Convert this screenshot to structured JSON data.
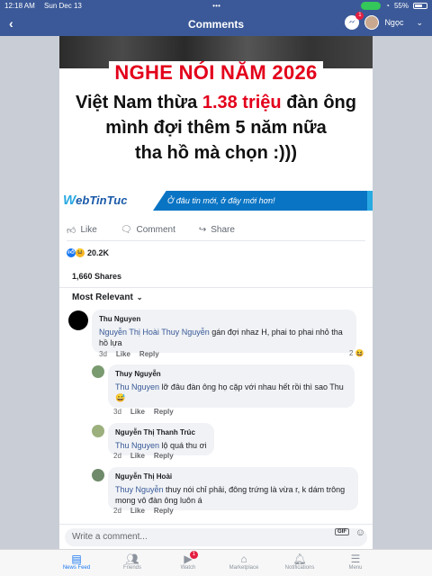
{
  "status_bar": {
    "time": "12:18 AM",
    "date": "Sun Dec 13",
    "battery": "55%",
    "dots": "• • •"
  },
  "nav": {
    "back": "‹",
    "title": "Comments",
    "messenger_badge": "1",
    "user_name": "Ngọc",
    "chevron": "⌄"
  },
  "post": {
    "image": {
      "headline_red": "NGHE NÓI NĂM 2026",
      "line1_pre": "Việt Nam thừa ",
      "line1_red": "1.38 triệu",
      "line1_post": " đàn ông",
      "line2": "mình đợi thêm 5 năm nữa",
      "line3": "tha hồ mà chọn :)))",
      "brand": "WebTinTuc",
      "brand_w": "W",
      "brand_rest": "ebTinTuc",
      "slogan": "Ở đâu tin mới, ở đây mới hơn!"
    },
    "actions": {
      "like": "Like",
      "comment": "Comment",
      "share": "Share"
    },
    "reaction_count": "20.2K",
    "shares": "1,660 Shares",
    "sort_label": "Most Relevant"
  },
  "comments": [
    {
      "author": "Thu Nguyen",
      "mention": "Nguyễn Thị Hoài Thuy Nguyễn",
      "text": " gán đợi nhaz H, phai to phai nhỏ tha hồ lựa",
      "time": "3d",
      "like": "Like",
      "reply": "Reply",
      "reaction_count": "2"
    },
    {
      "author": "Thuy Nguyễn",
      "mention": "Thu Nguyen",
      "text": " lỡ đâu đàn ông họ cặp với nhau hết rồi thì sao Thu 😅",
      "time": "3d",
      "like": "Like",
      "reply": "Reply"
    },
    {
      "author": "Nguyễn Thị Thanh Trúc",
      "mention": "Thu Nguyen",
      "text": " lộ quá thu ơi",
      "time": "2d",
      "like": "Like",
      "reply": "Reply"
    },
    {
      "author": "Nguyễn Thị Hoài",
      "mention": "Thuy Nguyễn",
      "text": " thuy nói chỉ phải, đông trứng là vừa r, k dám trông mong vô đàn ông luôn á",
      "time": "2d",
      "like": "Like",
      "reply": "Reply"
    }
  ],
  "write_comment": {
    "placeholder": "Write a comment...",
    "gif": "GIF"
  },
  "tabs": [
    {
      "label": "News Feed",
      "icon": "news-feed-icon",
      "active": true
    },
    {
      "label": "Friends",
      "icon": "friends-icon"
    },
    {
      "label": "Watch",
      "icon": "watch-icon",
      "badge": "1"
    },
    {
      "label": "Marketplace",
      "icon": "marketplace-icon"
    },
    {
      "label": "Notifications",
      "icon": "notifications-icon"
    },
    {
      "label": "Menu",
      "icon": "menu-icon"
    }
  ],
  "colors": {
    "brand_blue": "#3b5998",
    "link": "#385898",
    "accent": "#1877f2",
    "headline_red": "#e3001b"
  }
}
